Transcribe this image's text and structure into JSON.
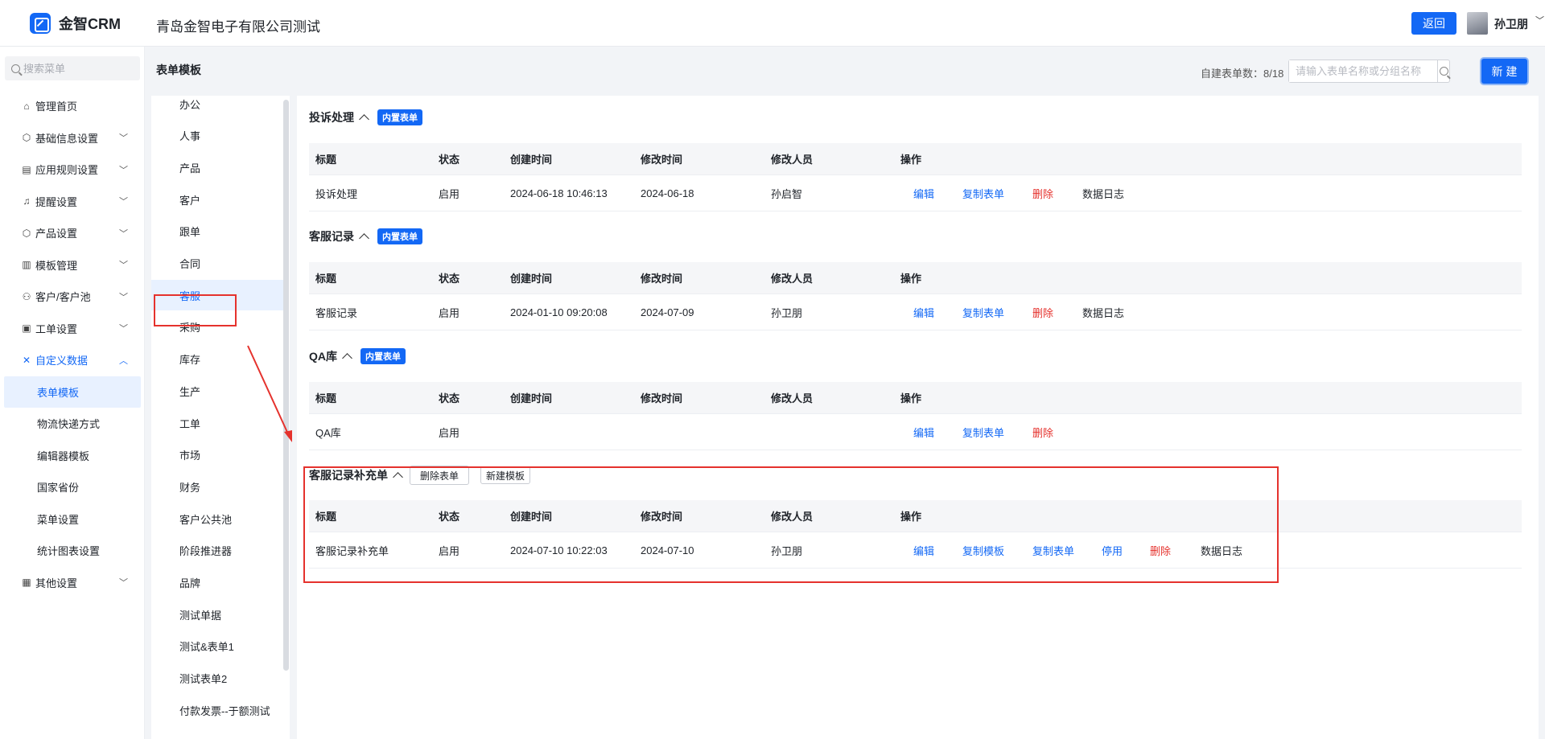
{
  "app": {
    "logo_text": "金智CRM",
    "company": "青岛金智电子有限公司测试"
  },
  "header": {
    "back_label": "返回",
    "user_name": "孙卫朋"
  },
  "sidebar": {
    "search_placeholder": "搜索菜单",
    "items": [
      {
        "label": "管理首页",
        "icon": "home-icon",
        "expandable": false
      },
      {
        "label": "基础信息设置",
        "icon": "cube-icon",
        "expandable": true
      },
      {
        "label": "应用规则设置",
        "icon": "doc-icon",
        "expandable": true
      },
      {
        "label": "提醒设置",
        "icon": "bell-icon",
        "expandable": true
      },
      {
        "label": "产品设置",
        "icon": "cube-icon",
        "expandable": true
      },
      {
        "label": "模板管理",
        "icon": "template-icon",
        "expandable": true
      },
      {
        "label": "客户/客户池",
        "icon": "user-icon",
        "expandable": true
      },
      {
        "label": "工单设置",
        "icon": "ticket-icon",
        "expandable": true
      },
      {
        "label": "自定义数据",
        "icon": "custom-icon",
        "expandable": true,
        "expanded": true
      }
    ],
    "sub_items": [
      "表单模板",
      "物流快递方式",
      "编辑器模板",
      "国家省份",
      "菜单设置",
      "统计图表设置"
    ],
    "selected_sub": "表单模板",
    "last_item": {
      "label": "其他设置",
      "icon": "grid-icon"
    }
  },
  "page": {
    "title": "表单模板",
    "count_label": "自建表单数：8/18",
    "search_placeholder": "请输入表单名称或分组名称",
    "new_label": "新 建"
  },
  "categories": [
    "办公",
    "人事",
    "产品",
    "客户",
    "跟单",
    "合同",
    "客服",
    "采购",
    "库存",
    "生产",
    "工单",
    "市场",
    "财务",
    "客户公共池",
    "阶段推进器",
    "品牌",
    "测试单据",
    "测试&表单1",
    "测试表单2",
    "付款发票--于额测试"
  ],
  "selected_category": "客服",
  "columns": [
    "标题",
    "状态",
    "创建时间",
    "修改时间",
    "修改人员",
    "操作"
  ],
  "sections": [
    {
      "title": "投诉处理",
      "tag": "内置表单",
      "row": {
        "title": "投诉处理",
        "status": "启用",
        "created": "2024-06-18 10:46:13",
        "modified": "2024-06-18",
        "modifier": "孙启智",
        "ops": [
          {
            "label": "编辑",
            "color": "blue"
          },
          {
            "label": "复制表单",
            "color": "blue"
          },
          {
            "label": "删除",
            "color": "red"
          },
          {
            "label": "数据日志",
            "color": "black"
          }
        ]
      }
    },
    {
      "title": "客服记录",
      "tag": "内置表单",
      "row": {
        "title": "客服记录",
        "status": "启用",
        "created": "2024-01-10 09:20:08",
        "modified": "2024-07-09",
        "modifier": "孙卫朋",
        "ops": [
          {
            "label": "编辑",
            "color": "blue"
          },
          {
            "label": "复制表单",
            "color": "blue"
          },
          {
            "label": "删除",
            "color": "red"
          },
          {
            "label": "数据日志",
            "color": "black"
          }
        ]
      }
    },
    {
      "title": "QA库",
      "tag": "内置表单",
      "row": {
        "title": "QA库",
        "status": "启用",
        "created": "",
        "modified": "",
        "modifier": "",
        "ops": [
          {
            "label": "编辑",
            "color": "blue"
          },
          {
            "label": "复制表单",
            "color": "blue"
          },
          {
            "label": "删除",
            "color": "red"
          }
        ]
      }
    },
    {
      "title": "客服记录补充单",
      "buttons": [
        "删除表单",
        "新建模板"
      ],
      "row": {
        "title": "客服记录补充单",
        "status": "启用",
        "created": "2024-07-10 10:22:03",
        "modified": "2024-07-10",
        "modifier": "孙卫朋",
        "ops": [
          {
            "label": "编辑",
            "color": "blue"
          },
          {
            "label": "复制模板",
            "color": "blue"
          },
          {
            "label": "复制表单",
            "color": "blue"
          },
          {
            "label": "停用",
            "color": "blue"
          },
          {
            "label": "删除",
            "color": "red"
          },
          {
            "label": "数据日志",
            "color": "black"
          }
        ]
      }
    }
  ],
  "colors": {
    "accent": "#1368f5",
    "danger": "#e5322d",
    "highlight_box": "#e5322d"
  }
}
